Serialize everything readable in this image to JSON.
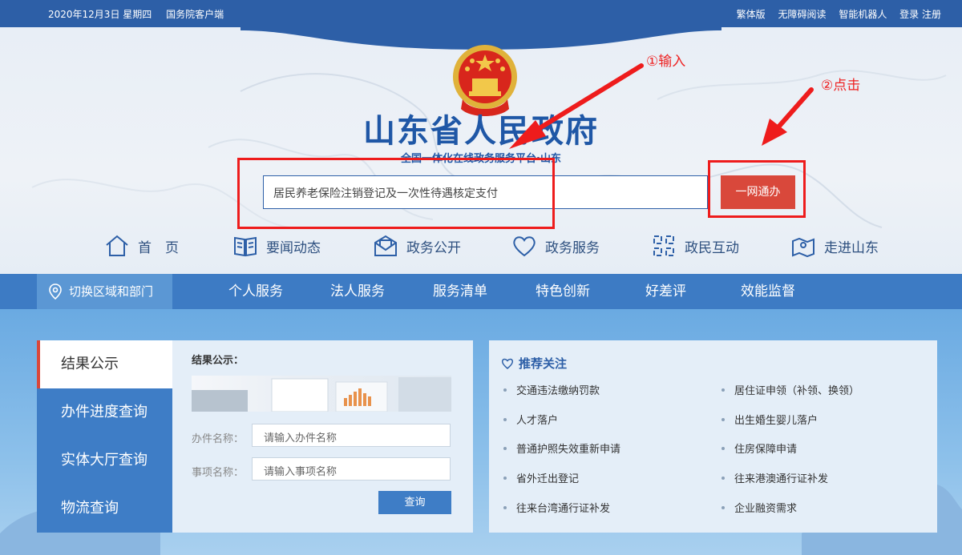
{
  "topbar": {
    "date": "2020年12月3日 星期四",
    "client": "国务院客户端",
    "links": [
      "繁体版",
      "无障碍阅读",
      "智能机器人",
      "登录 注册"
    ]
  },
  "header": {
    "title": "山东省人民政府",
    "subtitle": "全国一体化在线政务服务平台·山东"
  },
  "search": {
    "value": "居民养老保险注销登记及一次性待遇核定支付",
    "button_label": "一网通办"
  },
  "annotations": {
    "step1": "①输入",
    "step2": "②点击"
  },
  "nav": [
    {
      "label": "首　页",
      "icon": "home-icon"
    },
    {
      "label": "要闻动态",
      "icon": "book-icon"
    },
    {
      "label": "政务公开",
      "icon": "mail-icon"
    },
    {
      "label": "政务服务",
      "icon": "heart-icon"
    },
    {
      "label": "政民互动",
      "icon": "interaction-icon"
    },
    {
      "label": "走进山东",
      "icon": "location-icon"
    }
  ],
  "menubar": {
    "switch_label": "切换区域和部门",
    "items": [
      "个人服务",
      "法人服务",
      "服务清单",
      "特色创新",
      "好差评",
      "效能监督"
    ]
  },
  "sidetabs": [
    "结果公示",
    "办件进度查询",
    "实体大厅查询",
    "物流查询"
  ],
  "result_panel": {
    "title": "结果公示：",
    "field1_label": "办件名称：",
    "field1_placeholder": "请输入办件名称",
    "field2_label": "事项名称：",
    "field2_placeholder": "请输入事项名称",
    "query_button": "查询"
  },
  "recommend": {
    "title": "推荐关注",
    "left": [
      "交通违法缴纳罚款",
      "人才落户",
      "普通护照失效重新申请",
      "省外迁出登记",
      "往来台湾通行证补发"
    ],
    "right": [
      "居住证申领（补领、换领）",
      "出生婚生婴儿落户",
      "住房保障申请",
      "往来港澳通行证补发",
      "企业融资需求"
    ]
  },
  "colors": {
    "brand_blue": "#2d5fa7",
    "accent_red": "#d9483b",
    "annotation_red": "#ee1c1c"
  }
}
